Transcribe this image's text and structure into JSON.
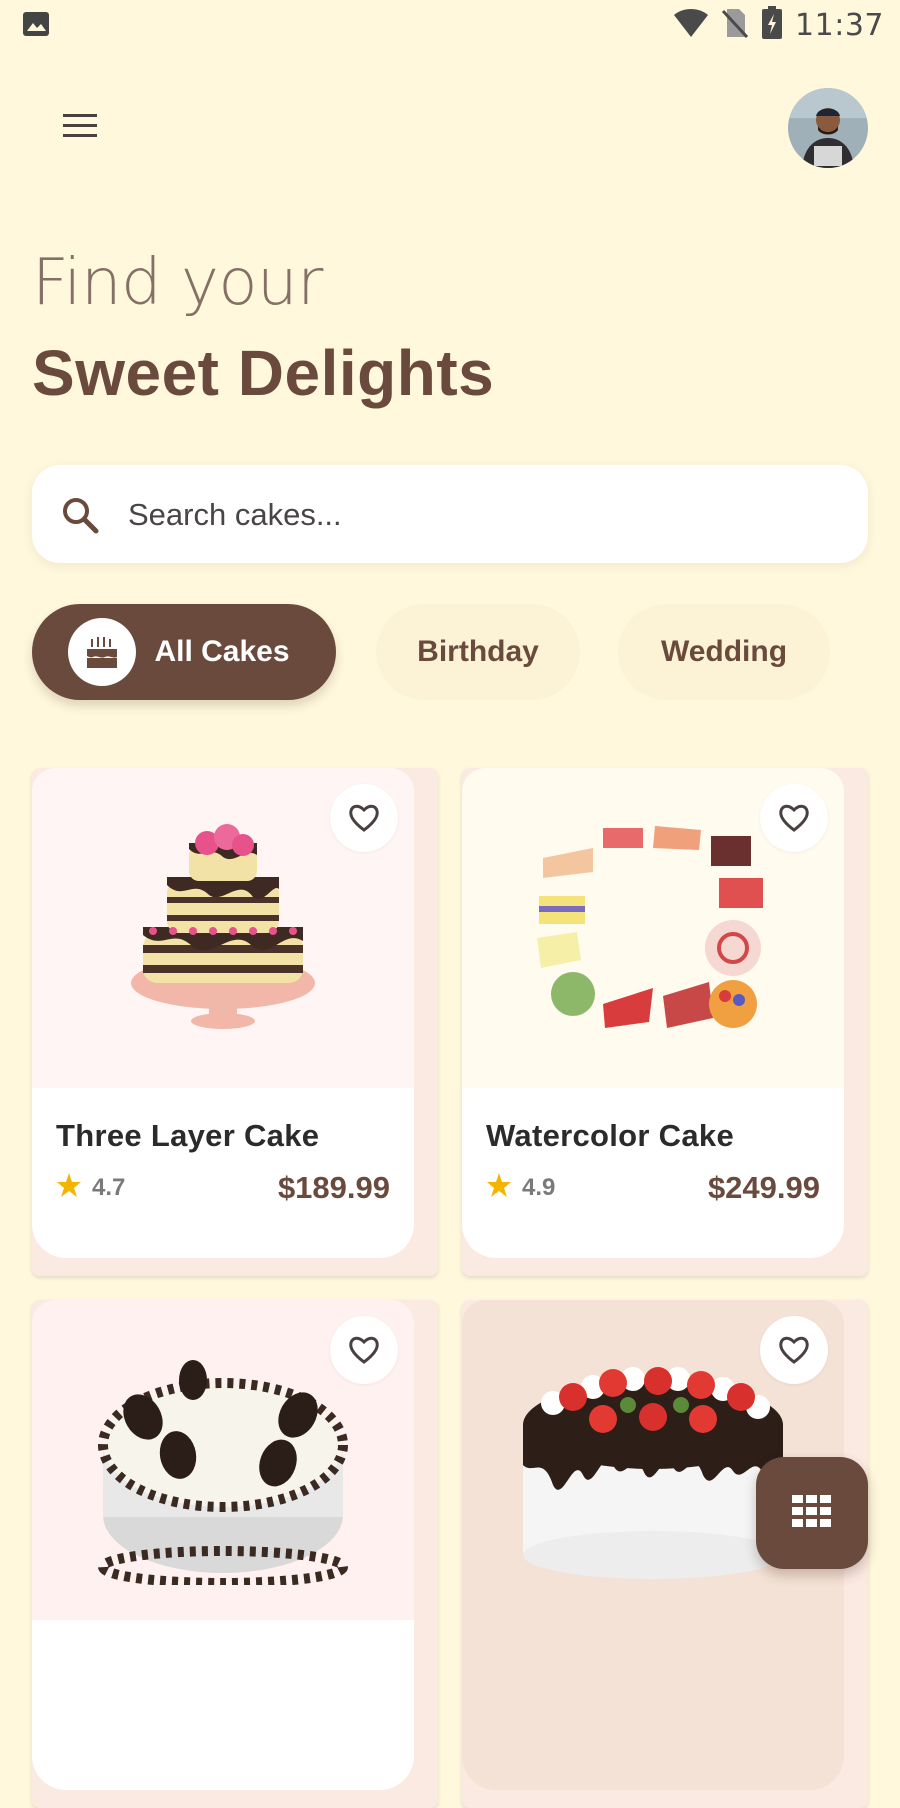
{
  "status_bar": {
    "time": "11:37",
    "icons": [
      "image-icon",
      "wifi-icon",
      "no-sim-icon",
      "battery-charging-icon"
    ]
  },
  "header": {
    "menu_icon": "hamburger-menu-icon",
    "avatar_icon": "user-avatar"
  },
  "hero": {
    "line1": "Find your",
    "line2": "Sweet Delights"
  },
  "search": {
    "placeholder": "Search cakes...",
    "value": "",
    "icon": "search-icon"
  },
  "categories": [
    {
      "label": "All Cakes",
      "active": true,
      "icon": "birthday-cake-icon"
    },
    {
      "label": "Birthday",
      "active": false
    },
    {
      "label": "Wedding",
      "active": false
    }
  ],
  "products": [
    {
      "name": "Three Layer Cake",
      "rating": "4.7",
      "price": "$189.99"
    },
    {
      "name": "Watercolor Cake",
      "rating": "4.9",
      "price": "$249.99"
    },
    {
      "name": "",
      "rating": "",
      "price": ""
    },
    {
      "name": "",
      "rating": "",
      "price": ""
    }
  ],
  "colors": {
    "background": "#FFF8DD",
    "brand_brown": "#6B4A3E",
    "star": "#F5B400",
    "card": "#FFFFFF"
  },
  "fab": {
    "icon": "grid-view-icon"
  }
}
